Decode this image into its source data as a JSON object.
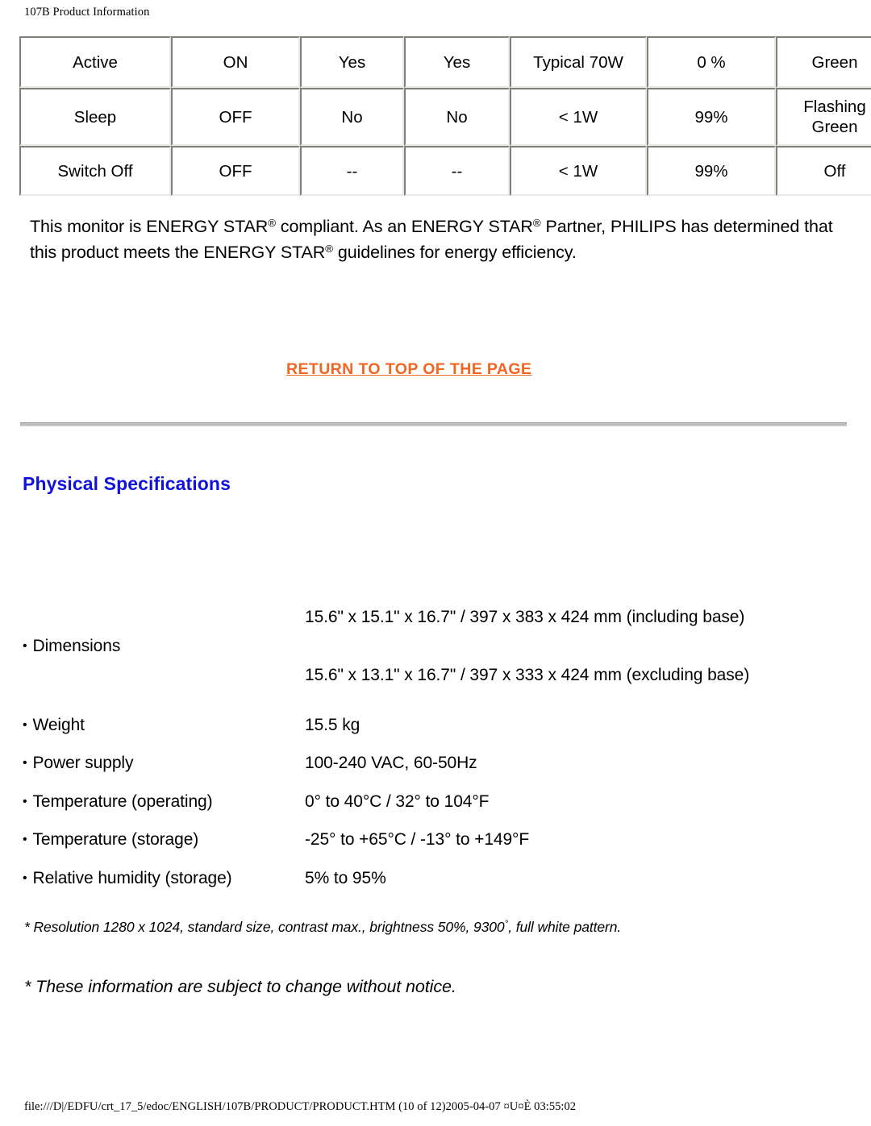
{
  "header": {
    "title": "107B Product Information"
  },
  "power_table": {
    "rows": [
      {
        "mode": "Active",
        "video": "ON",
        "h_sync": "Yes",
        "v_sync": "Yes",
        "power_used": "Typical 70W",
        "power_saving": "0 %",
        "led_color": "Green"
      },
      {
        "mode": "Sleep",
        "video": "OFF",
        "h_sync": "No",
        "v_sync": "No",
        "power_used": "< 1W",
        "power_saving": "99%",
        "led_color": "Flashing Green"
      },
      {
        "mode": "Switch Off",
        "video": "OFF",
        "h_sync": "--",
        "v_sync": "--",
        "power_used": "< 1W",
        "power_saving": "99%",
        "led_color": "Off"
      }
    ]
  },
  "energy_star": {
    "line1_part1": "This monitor is ENERGY STAR",
    "line1_part2": " compliant. As an ENERGY STAR",
    "line1_part3": " Partner, PHILIPS has determined that this product meets the ENERGY STAR",
    "line1_part4": " guidelines for energy efficiency.",
    "registered_mark": "®"
  },
  "return_link": {
    "label": "RETURN TO TOP OF THE PAGE",
    "color": "#f26522"
  },
  "physical_specs": {
    "heading": "Physical Specifications",
    "heading_color": "#1111dd",
    "rows": [
      {
        "label": "Dimensions",
        "value_line1": "15.6\" x 15.1\" x 16.7\" / 397 x 383 x 424 mm (including base)",
        "value_line2": "15.6\" x 13.1\" x 16.7\" / 397 x 333 x 424 mm (excluding base)"
      },
      {
        "label": "Weight",
        "value": "15.5 kg"
      },
      {
        "label": "Power supply",
        "value": "100-240 VAC, 60-50Hz"
      },
      {
        "label": "Temperature (operating)",
        "value": "0° to 40°C / 32° to 104°F"
      },
      {
        "label": "Temperature (storage)",
        "value": "-25° to +65°C / -13° to +149°F"
      },
      {
        "label": "Relative humidity (storage)",
        "value": "5% to 95%"
      }
    ],
    "bullet_glyph": "•"
  },
  "footnotes": {
    "note1_before": "* Resolution 1280 x 1024, standard size, contrast max., brightness 50%, 9300",
    "note1_sup": "°",
    "note1_after": ", full white pattern.",
    "note2": "* These information are subject to change without notice."
  },
  "footer": {
    "text": "file:///D|/EDFU/crt_17_5/edoc/ENGLISH/107B/PRODUCT/PRODUCT.HTM (10 of 12)2005-04-07 ¤U¤È 03:55:02"
  }
}
